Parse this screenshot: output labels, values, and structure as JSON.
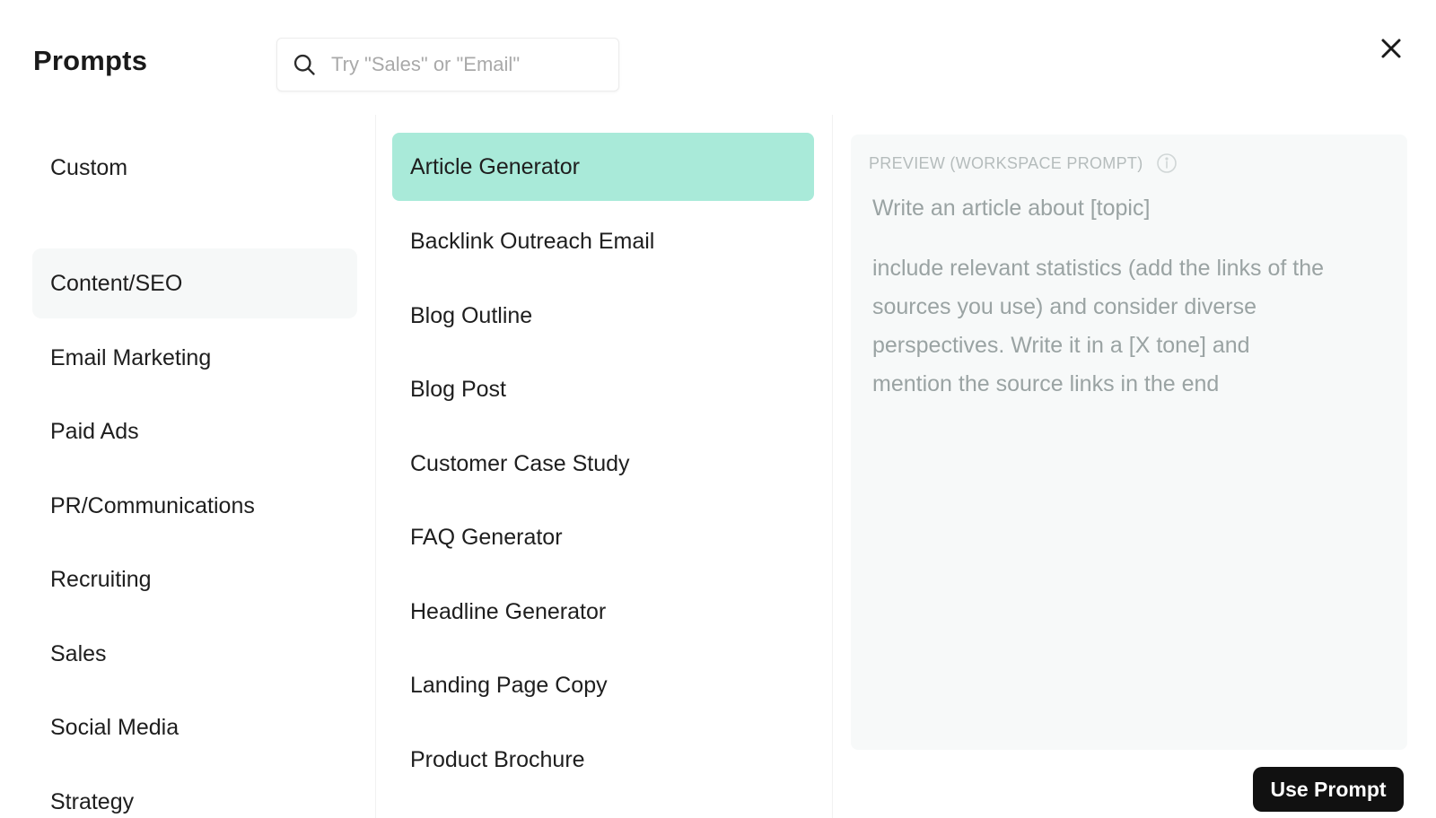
{
  "header": {
    "title": "Prompts",
    "search_placeholder": "Try \"Sales\" or \"Email\"",
    "search_value": ""
  },
  "categories": [
    {
      "label": "Custom",
      "active": false
    },
    {
      "label": "Content/SEO",
      "active": true
    },
    {
      "label": "Email Marketing",
      "active": false
    },
    {
      "label": "Paid Ads",
      "active": false
    },
    {
      "label": "PR/Communications",
      "active": false
    },
    {
      "label": "Recruiting",
      "active": false
    },
    {
      "label": "Sales",
      "active": false
    },
    {
      "label": "Social Media",
      "active": false
    },
    {
      "label": "Strategy",
      "active": false
    }
  ],
  "prompts": [
    {
      "label": "Article Generator",
      "active": true
    },
    {
      "label": "Backlink Outreach Email",
      "active": false
    },
    {
      "label": "Blog Outline",
      "active": false
    },
    {
      "label": "Blog Post",
      "active": false
    },
    {
      "label": "Customer Case Study",
      "active": false
    },
    {
      "label": "FAQ Generator",
      "active": false
    },
    {
      "label": "Headline Generator",
      "active": false
    },
    {
      "label": "Landing Page Copy",
      "active": false
    },
    {
      "label": "Product Brochure",
      "active": false
    }
  ],
  "preview": {
    "label": "PREVIEW (WORKSPACE PROMPT)",
    "line1": "Write an article about [topic]",
    "body_lines": [
      "include relevant statistics (add the links of the",
      "sources you use) and consider diverse",
      "perspectives. Write it in a [X tone] and",
      "mention the source links in the end"
    ]
  },
  "actions": {
    "use_prompt_label": "Use Prompt"
  },
  "colors": {
    "accent_selected": "#a9ead9",
    "active_category_bg": "#f6f8f8",
    "preview_bg": "#f7f9f9",
    "button_bg": "#111111"
  }
}
